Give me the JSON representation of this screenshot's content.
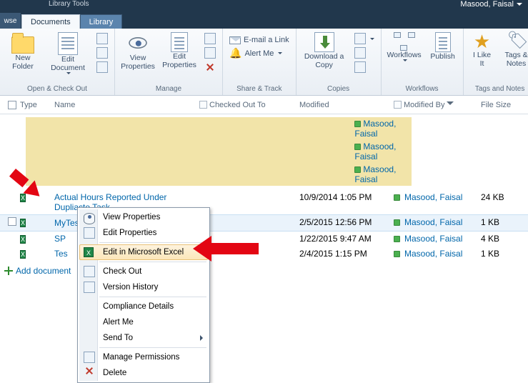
{
  "topbar": {
    "tools_label": "Library Tools",
    "user_name": "Masood, Faisal"
  },
  "tabs": {
    "back": "wse",
    "documents": "Documents",
    "library": "Library"
  },
  "ribbon": {
    "groups": {
      "open_checkout": {
        "label": "Open & Check Out",
        "new_folder": "New\nFolder",
        "edit_document": "Edit\nDocument"
      },
      "manage": {
        "label": "Manage",
        "view_properties": "View\nProperties",
        "edit_properties": "Edit\nProperties"
      },
      "share_track": {
        "label": "Share & Track",
        "email_link": "E-mail a Link",
        "alert_me": "Alert Me"
      },
      "copies": {
        "label": "Copies",
        "download": "Download a\nCopy"
      },
      "workflows": {
        "label": "Workflows",
        "workflows": "Workflows",
        "publish": "Publish"
      },
      "tags_notes": {
        "label": "Tags and Notes",
        "like": "I Like\nIt",
        "tags": "Tags &\nNotes"
      }
    }
  },
  "grid": {
    "headers": {
      "type": "Type",
      "name": "Name",
      "checked_out": "Checked Out To",
      "modified": "Modified",
      "modified_by": "Modified By",
      "file_size": "File Size"
    },
    "highlight_users": [
      "Masood, Faisal",
      "Masood, Faisal",
      "Masood, Faisal"
    ],
    "rows": [
      {
        "name": "Actual Hours Reported Under Dupliacte Task",
        "modified": "10/9/2014 1:05 PM",
        "modified_by": "Masood, Faisal",
        "size": "24 KB"
      },
      {
        "name": "MyTestCSVFile",
        "modified": "2/5/2015 12:56 PM",
        "modified_by": "Masood, Faisal",
        "size": "1 KB"
      },
      {
        "name": "SP",
        "modified": "1/22/2015 9:47 AM",
        "modified_by": "Masood, Faisal",
        "size": "4 KB"
      },
      {
        "name": "Tes",
        "modified": "2/4/2015 1:15 PM",
        "modified_by": "Masood, Faisal",
        "size": "1 KB"
      }
    ],
    "add_document": "Add document"
  },
  "context_menu": {
    "view_properties": "View Properties",
    "edit_properties": "Edit Properties",
    "edit_excel": "Edit in Microsoft Excel",
    "check_out": "Check Out",
    "version_history": "Version History",
    "compliance": "Compliance Details",
    "alert_me": "Alert Me",
    "send_to": "Send To",
    "manage_permissions": "Manage Permissions",
    "delete": "Delete"
  }
}
